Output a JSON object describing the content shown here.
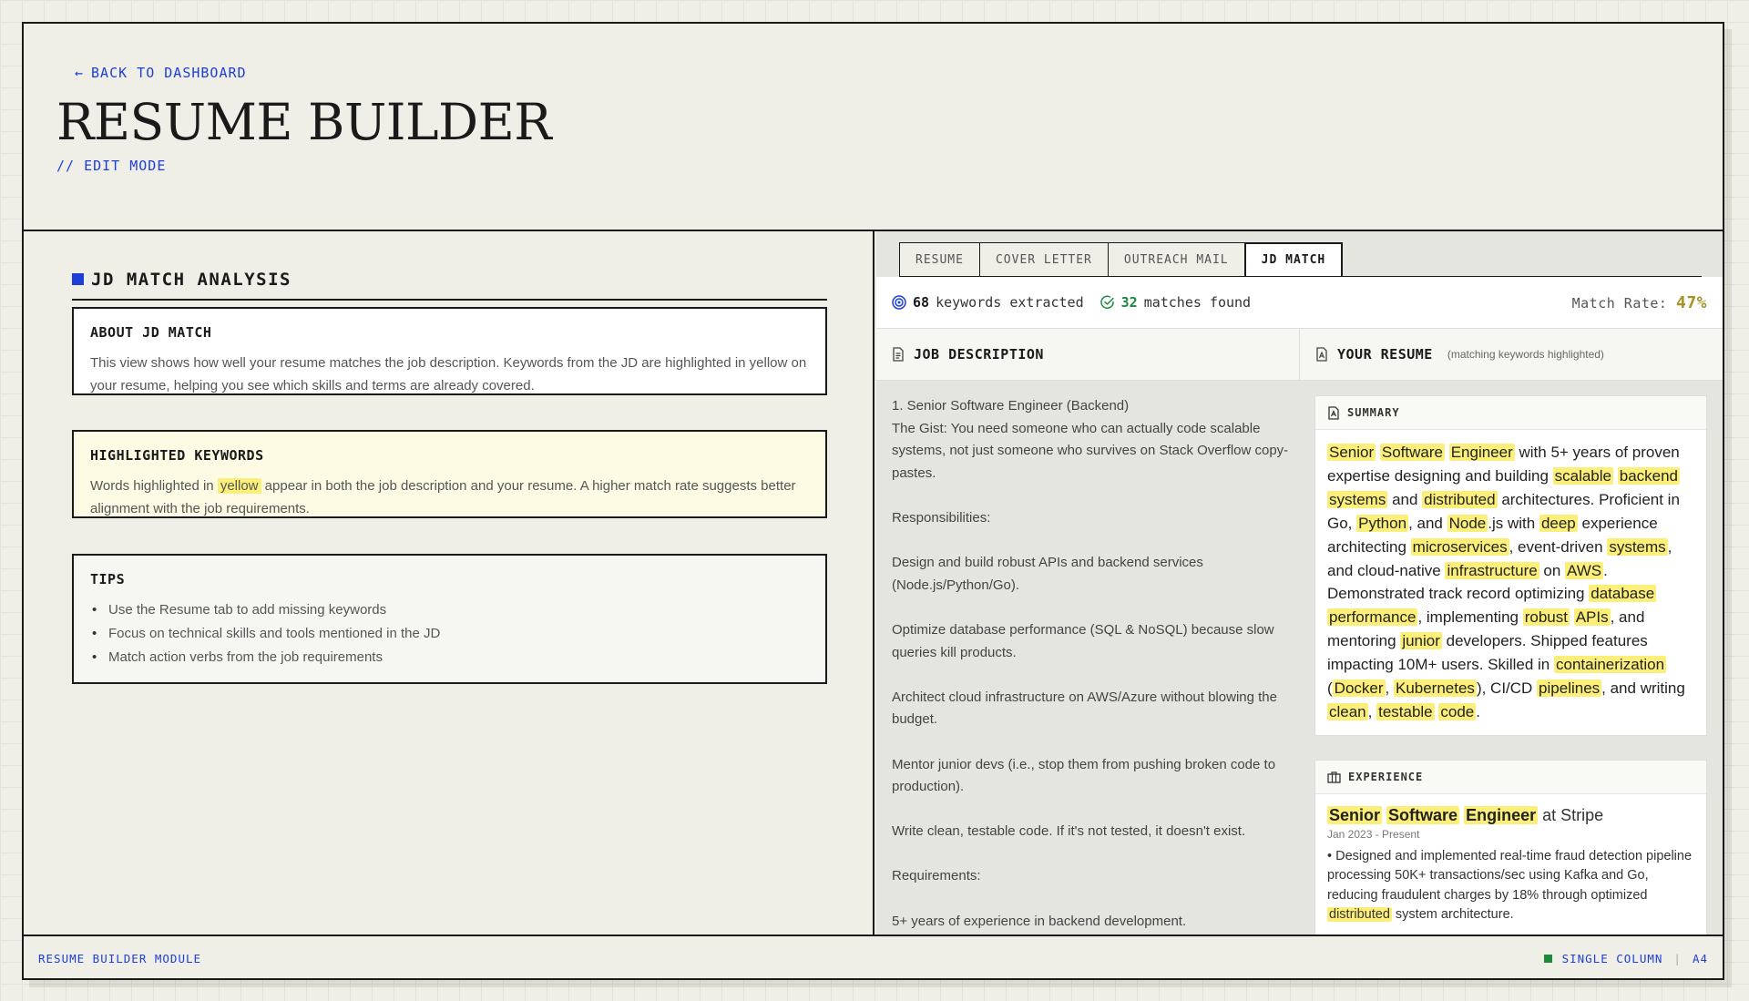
{
  "header": {
    "back_label": "BACK TO DASHBOARD",
    "title": "RESUME BUILDER",
    "mode": "// EDIT MODE"
  },
  "left": {
    "section_title": "JD MATCH ANALYSIS",
    "about": {
      "title": "ABOUT JD MATCH",
      "text": "This view shows how well your resume matches the job description. Keywords from the JD are highlighted in yellow on your resume, helping you see which skills and terms are already covered."
    },
    "keywords": {
      "title": "HIGHLIGHTED KEYWORDS",
      "text_before": "Words highlighted in",
      "highlight_word": "yellow",
      "text_after": "appear in both the job description and your resume. A higher match rate suggests better alignment with the job requirements."
    },
    "tips": {
      "title": "TIPS",
      "items": [
        "Use the Resume tab to add missing keywords",
        "Focus on technical skills and tools mentioned in the JD",
        "Match action verbs from the job requirements"
      ]
    }
  },
  "tabs": [
    "RESUME",
    "COVER LETTER",
    "OUTREACH MAIL",
    "JD MATCH"
  ],
  "active_tab": "JD MATCH",
  "stats": {
    "keywords_count": "68",
    "keywords_label": "keywords extracted",
    "matches_count": "32",
    "matches_label": "matches found",
    "match_rate_label": "Match Rate:",
    "match_rate_value": "47%"
  },
  "columns": {
    "jd_title": "JOB DESCRIPTION",
    "resume_title": "YOUR RESUME",
    "resume_subtitle": "(matching keywords highlighted)"
  },
  "job_description": [
    "1. Senior Software Engineer (Backend)",
    "The Gist: You need someone who can actually code scalable systems, not just someone who survives on Stack Overflow copy-pastes.",
    "",
    "Responsibilities:",
    "",
    "Design and build robust APIs and backend services (Node.js/Python/Go).",
    "",
    "Optimize database performance (SQL & NoSQL) because slow queries kill products.",
    "",
    "Architect cloud infrastructure on AWS/Azure without blowing the budget.",
    "",
    "Mentor junior devs (i.e., stop them from pushing broken code to production).",
    "",
    "Write clean, testable code. If it's not tested, it doesn't exist.",
    "",
    "Requirements:",
    "",
    "5+ years of experience in backend development."
  ],
  "resume": {
    "summary_title": "SUMMARY",
    "summary_segments": [
      {
        "t": "Senior",
        "h": true
      },
      {
        "t": " "
      },
      {
        "t": "Software",
        "h": true
      },
      {
        "t": " "
      },
      {
        "t": "Engineer",
        "h": true
      },
      {
        "t": " with 5+ years of proven expertise designing and building "
      },
      {
        "t": "scalable",
        "h": true
      },
      {
        "t": " "
      },
      {
        "t": "backend",
        "h": true
      },
      {
        "t": " "
      },
      {
        "t": "systems",
        "h": true
      },
      {
        "t": " and "
      },
      {
        "t": "distributed",
        "h": true
      },
      {
        "t": " architectures. Proficient in Go, "
      },
      {
        "t": "Python",
        "h": true
      },
      {
        "t": ", and "
      },
      {
        "t": "Node",
        "h": true
      },
      {
        "t": ".js with "
      },
      {
        "t": "deep",
        "h": true
      },
      {
        "t": " experience architecting "
      },
      {
        "t": "microservices",
        "h": true
      },
      {
        "t": ", event-driven "
      },
      {
        "t": "systems",
        "h": true
      },
      {
        "t": ", and cloud-native "
      },
      {
        "t": "infrastructure",
        "h": true
      },
      {
        "t": " on "
      },
      {
        "t": "AWS",
        "h": true
      },
      {
        "t": ". Demonstrated track record optimizing "
      },
      {
        "t": "database",
        "h": true
      },
      {
        "t": " "
      },
      {
        "t": "performance",
        "h": true
      },
      {
        "t": ", implementing "
      },
      {
        "t": "robust",
        "h": true
      },
      {
        "t": " "
      },
      {
        "t": "APIs",
        "h": true
      },
      {
        "t": ", and mentoring "
      },
      {
        "t": "junior",
        "h": true
      },
      {
        "t": " developers. Shipped features impacting 10M+ users. Skilled in "
      },
      {
        "t": "containerization",
        "h": true
      },
      {
        "t": " ("
      },
      {
        "t": "Docker",
        "h": true
      },
      {
        "t": ", "
      },
      {
        "t": "Kubernetes",
        "h": true
      },
      {
        "t": "), CI/CD "
      },
      {
        "t": "pipelines",
        "h": true
      },
      {
        "t": ", and writing "
      },
      {
        "t": "clean",
        "h": true
      },
      {
        "t": ", "
      },
      {
        "t": "testable",
        "h": true
      },
      {
        "t": " "
      },
      {
        "t": "code",
        "h": true
      },
      {
        "t": "."
      }
    ],
    "experience_title": "EXPERIENCE",
    "experience": {
      "role_segments": [
        {
          "t": "Senior",
          "h": true
        },
        {
          "t": " "
        },
        {
          "t": "Software",
          "h": true
        },
        {
          "t": " "
        },
        {
          "t": "Engineer",
          "h": true
        }
      ],
      "company": " at Stripe",
      "dates": "Jan 2023 - Present",
      "bullet_segments": [
        {
          "t": "•  Designed and implemented real-time fraud detection pipeline processing 50K+ transactions/sec using Kafka and Go, reducing fraudulent charges by 18% through optimized "
        },
        {
          "t": "distributed",
          "h": true
        },
        {
          "t": " system architecture."
        }
      ]
    }
  },
  "footer": {
    "module": "RESUME BUILDER MODULE",
    "layout": "SINGLE COLUMN",
    "separator": "|",
    "paper": "A4"
  },
  "colors": {
    "accent": "#1d3fd6",
    "highlight": "#fbef7a",
    "success": "#1b8a3c",
    "match_rate": "#a39325"
  },
  "icons": {
    "back": "arrow-left-icon",
    "keywords": "target-icon",
    "matches": "check-circle-icon",
    "jd": "document-icon",
    "resume": "resume-file-icon",
    "summary": "summary-icon",
    "experience": "briefcase-icon"
  }
}
